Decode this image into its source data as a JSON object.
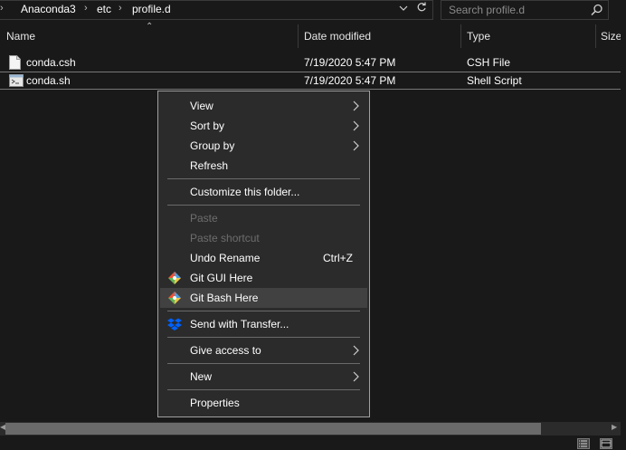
{
  "address": {
    "breadcrumbs": [
      "Anaconda3",
      "etc",
      "profile.d"
    ],
    "search_placeholder": "Search profile.d"
  },
  "columns": [
    "Name",
    "Date modified",
    "Type",
    "Size"
  ],
  "files": [
    {
      "name": "conda.csh",
      "date": "7/19/2020 5:47 PM",
      "type": "CSH File"
    },
    {
      "name": "conda.sh",
      "date": "7/19/2020 5:47 PM",
      "type": "Shell Script"
    }
  ],
  "menu": {
    "view": "View",
    "sort_by": "Sort by",
    "group_by": "Group by",
    "refresh": "Refresh",
    "customize": "Customize this folder...",
    "paste": "Paste",
    "paste_shortcut": "Paste shortcut",
    "undo_rename": "Undo Rename",
    "undo_shortcut": "Ctrl+Z",
    "git_gui": "Git GUI Here",
    "git_bash": "Git Bash Here",
    "send_transfer": "Send with Transfer...",
    "give_access": "Give access to",
    "new": "New",
    "properties": "Properties"
  },
  "colors": {
    "background": "#191919",
    "menu_bg": "#2b2b2b",
    "menu_hover": "#414141",
    "disabled_text": "#6d6d6d",
    "dropbox_blue": "#0061fe"
  }
}
